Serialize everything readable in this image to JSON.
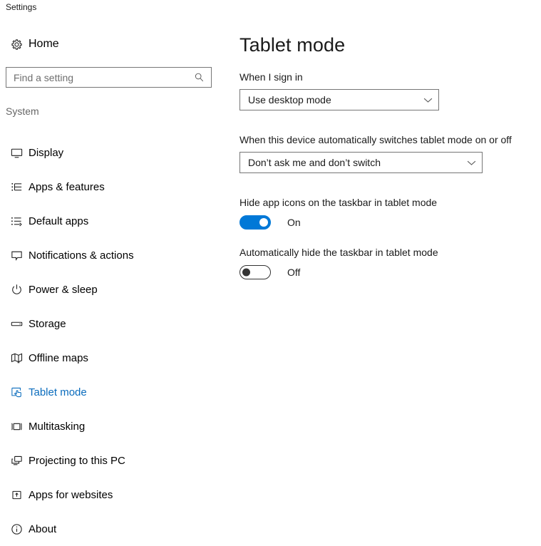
{
  "window": {
    "title": "Settings"
  },
  "sidebar": {
    "home": {
      "label": "Home",
      "icon": "gear-icon"
    },
    "search": {
      "value": "",
      "placeholder": "Find a setting",
      "icon": "search-icon"
    },
    "group_header": "System",
    "items": [
      {
        "label": "Display",
        "icon": "monitor-icon",
        "selected": false
      },
      {
        "label": "Apps & features",
        "icon": "list-icon",
        "selected": false
      },
      {
        "label": "Default apps",
        "icon": "list-arrow-icon",
        "selected": false
      },
      {
        "label": "Notifications & actions",
        "icon": "speech-bubble-icon",
        "selected": false
      },
      {
        "label": "Power & sleep",
        "icon": "power-icon",
        "selected": false
      },
      {
        "label": "Storage",
        "icon": "drive-icon",
        "selected": false
      },
      {
        "label": "Offline maps",
        "icon": "map-icon",
        "selected": false
      },
      {
        "label": "Tablet mode",
        "icon": "tablet-tap-icon",
        "selected": true
      },
      {
        "label": "Multitasking",
        "icon": "multitask-icon",
        "selected": false
      },
      {
        "label": "Projecting to this PC",
        "icon": "project-screen-icon",
        "selected": false
      },
      {
        "label": "Apps for websites",
        "icon": "app-link-icon",
        "selected": false
      },
      {
        "label": "About",
        "icon": "info-icon",
        "selected": false
      }
    ]
  },
  "content": {
    "title": "Tablet mode",
    "sign_in": {
      "label": "When I sign in",
      "selected_option": "Use desktop mode",
      "chevron": "chevron-down-icon"
    },
    "auto_switch": {
      "label": "When this device automatically switches tablet mode on or off",
      "selected_option": "Don’t ask me and don’t switch",
      "chevron": "chevron-down-icon"
    },
    "hide_app_icons": {
      "label": "Hide app icons on the taskbar in tablet mode",
      "state": "On"
    },
    "auto_hide_taskbar": {
      "label": "Automatically hide the taskbar in tablet mode",
      "state": "Off"
    }
  },
  "colors": {
    "accent": "#0078d7",
    "selected_text": "#0a6cbd",
    "border": "#767676",
    "group_header": "#666666"
  }
}
